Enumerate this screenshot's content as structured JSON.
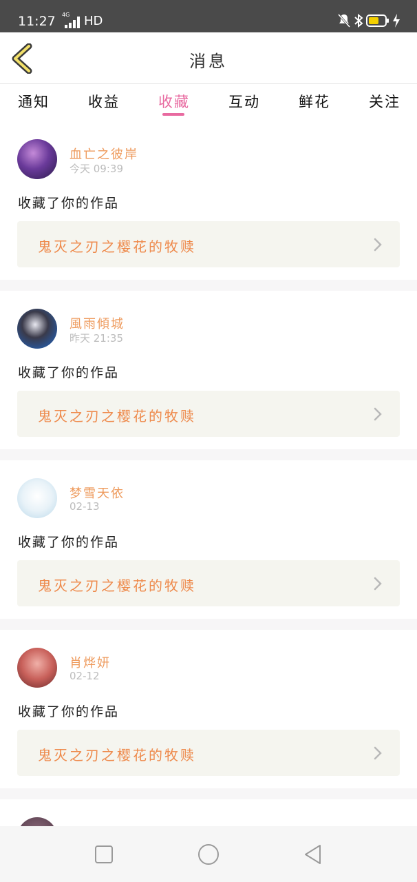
{
  "status": {
    "time": "11:27",
    "network": "4G",
    "hd": "HD"
  },
  "header": {
    "title": "消息"
  },
  "tabs": [
    {
      "label": "通知"
    },
    {
      "label": "收益"
    },
    {
      "label": "收藏"
    },
    {
      "label": "互动"
    },
    {
      "label": "鲜花"
    },
    {
      "label": "关注"
    }
  ],
  "active_tab": "收藏",
  "messages": [
    {
      "user": "血亡之彼岸",
      "time": "今天 09:39",
      "action": "收藏了你的作品",
      "work": "鬼灭之刃之樱花的牧赎"
    },
    {
      "user": "風雨傾城",
      "time": "昨天 21:35",
      "action": "收藏了你的作品",
      "work": "鬼灭之刃之樱花的牧赎"
    },
    {
      "user": "梦雪天依",
      "time": "02-13",
      "action": "收藏了你的作品",
      "work": "鬼灭之刃之樱花的牧赎"
    },
    {
      "user": "肖烨妍",
      "time": "02-12",
      "action": "收藏了你的作品",
      "work": "鬼灭之刃之樱花的牧赎"
    }
  ],
  "colors": {
    "accent": "#e86aa0",
    "name": "#ee9a5c",
    "work": "#ee8a4c",
    "card_bg": "#f5f5ef"
  }
}
